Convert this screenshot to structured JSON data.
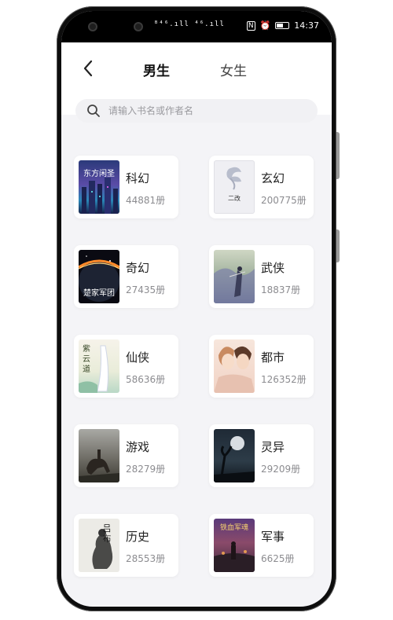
{
  "status_bar": {
    "left_text": "ᴮ⁴⁶.ıll ⁴⁶.ıll",
    "nfc_label": "N",
    "time": "14:37"
  },
  "header": {
    "tabs": [
      {
        "label": "男生",
        "active": true
      },
      {
        "label": "女生",
        "active": false
      }
    ],
    "search_placeholder": "请输入书名或作者名"
  },
  "colors": {
    "accent": "#f5b82e",
    "page_bg": "#f4f4f7",
    "card_bg": "#ffffff"
  },
  "categories": [
    {
      "name": "科幻",
      "count": "44881册",
      "cover_icon": "cyber-city-cover",
      "cover_text": "东方闲圣"
    },
    {
      "name": "玄幻",
      "count": "200775册",
      "cover_icon": "ink-cover",
      "cover_text": "二改"
    },
    {
      "name": "奇幻",
      "count": "27435册",
      "cover_icon": "planet-cover",
      "cover_text": "楚家军团"
    },
    {
      "name": "武侠",
      "count": "18837册",
      "cover_icon": "swordsman-cover",
      "cover_text": ""
    },
    {
      "name": "仙侠",
      "count": "58636册",
      "cover_icon": "waterfall-cover",
      "cover_text": "紫云道"
    },
    {
      "name": "都市",
      "count": "126352册",
      "cover_icon": "couple-cover",
      "cover_text": ""
    },
    {
      "name": "游戏",
      "count": "28279册",
      "cover_icon": "horseman-cover",
      "cover_text": ""
    },
    {
      "name": "灵异",
      "count": "29209册",
      "cover_icon": "moon-tree-cover",
      "cover_text": ""
    },
    {
      "name": "历史",
      "count": "28553册",
      "cover_icon": "ink-warrior-cover",
      "cover_text": "吕布"
    },
    {
      "name": "军事",
      "count": "6625册",
      "cover_icon": "battlefield-cover",
      "cover_text": "铁血军魂"
    }
  ]
}
